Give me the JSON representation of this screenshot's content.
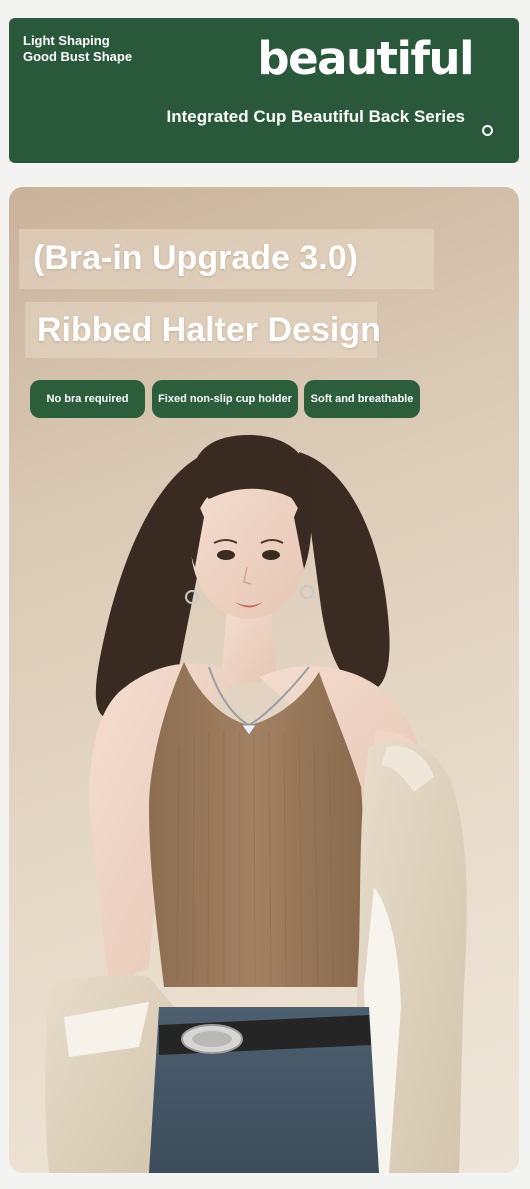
{
  "banner": {
    "tagline": "Light Shaping Good Bust Shape",
    "brand": "beautiful",
    "series": "Integrated Cup Beautiful Back Series"
  },
  "product": {
    "headline_1": "(Bra-in Upgrade 3.0)",
    "headline_2": "Ribbed Halter Design",
    "features": [
      "No bra required",
      "Fixed non-slip cup holder",
      "Soft and breathable"
    ]
  },
  "colors": {
    "banner_green": "#29593a",
    "pill_green": "#2c5e3c",
    "card_beige": "#e4d6c4",
    "top_brown": "#9a7a5b"
  },
  "icons": {
    "ring": "ring-icon"
  }
}
